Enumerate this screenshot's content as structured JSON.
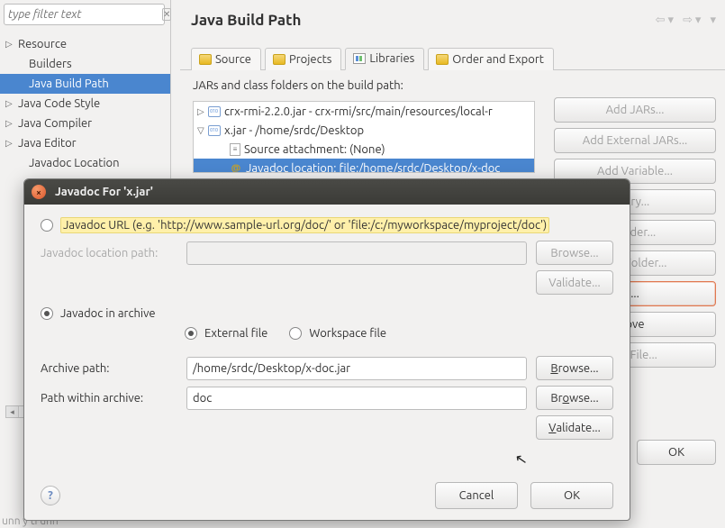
{
  "filter": {
    "placeholder": "type filter text"
  },
  "sidebar": {
    "items": [
      {
        "label": "Resource",
        "expandable": true,
        "selected": false
      },
      {
        "label": "Builders",
        "expandable": false,
        "selected": false
      },
      {
        "label": "Java Build Path",
        "expandable": false,
        "selected": true
      },
      {
        "label": "Java Code Style",
        "expandable": true,
        "selected": false
      },
      {
        "label": "Java Compiler",
        "expandable": true,
        "selected": false
      },
      {
        "label": "Java Editor",
        "expandable": true,
        "selected": false
      },
      {
        "label": "Javadoc Location",
        "expandable": false,
        "selected": false
      }
    ]
  },
  "header": {
    "title": "Java Build Path"
  },
  "tabs": [
    {
      "label": "Source",
      "active": false
    },
    {
      "label": "Projects",
      "active": false
    },
    {
      "label": "Libraries",
      "active": true
    },
    {
      "label": "Order and Export",
      "active": false
    }
  ],
  "subhead": "JARs and class folders on the build path:",
  "libtree": {
    "row0": "crx-rmi-2.2.0.jar - crx-rmi/src/main/resources/local-r",
    "row1": "x.jar - /home/srdc/Desktop",
    "row2": "Source attachment: (None)",
    "row3": "Javadoc location: file:/home/srdc/Desktop/x-doc"
  },
  "buttons": {
    "addJars": "Add JARs...",
    "addExternalJars": "Add External JARs...",
    "addVariable": "Add Variable...",
    "addLibrary": "rary...",
    "addClassFolder": "Folder...",
    "addExtClassFolder": "lass Folder...",
    "edit": "...",
    "remove": "ove",
    "migrate": "AR File...",
    "ok": "OK"
  },
  "dialog": {
    "title": "Javadoc For 'x.jar'",
    "urlRadio": "Javadoc URL (e.g. 'http://www.sample-url.org/doc/' or 'file:/c:/myworkspace/myproject/doc')",
    "locPathLabel": "Javadoc location path:",
    "archiveRadio": "Javadoc in archive",
    "externalFile": "External file",
    "workspaceFile": "Workspace file",
    "archivePathLabel": "Archive path:",
    "archivePathValue": "/home/srdc/Desktop/x-doc.jar",
    "pathWithinLabel": "Path within archive:",
    "pathWithinValue": "doc",
    "browse": "Browse...",
    "validate": "Validate...",
    "cancel": "Cancel",
    "ok": "OK"
  },
  "bgtext": "unn\ny ti\nunn"
}
